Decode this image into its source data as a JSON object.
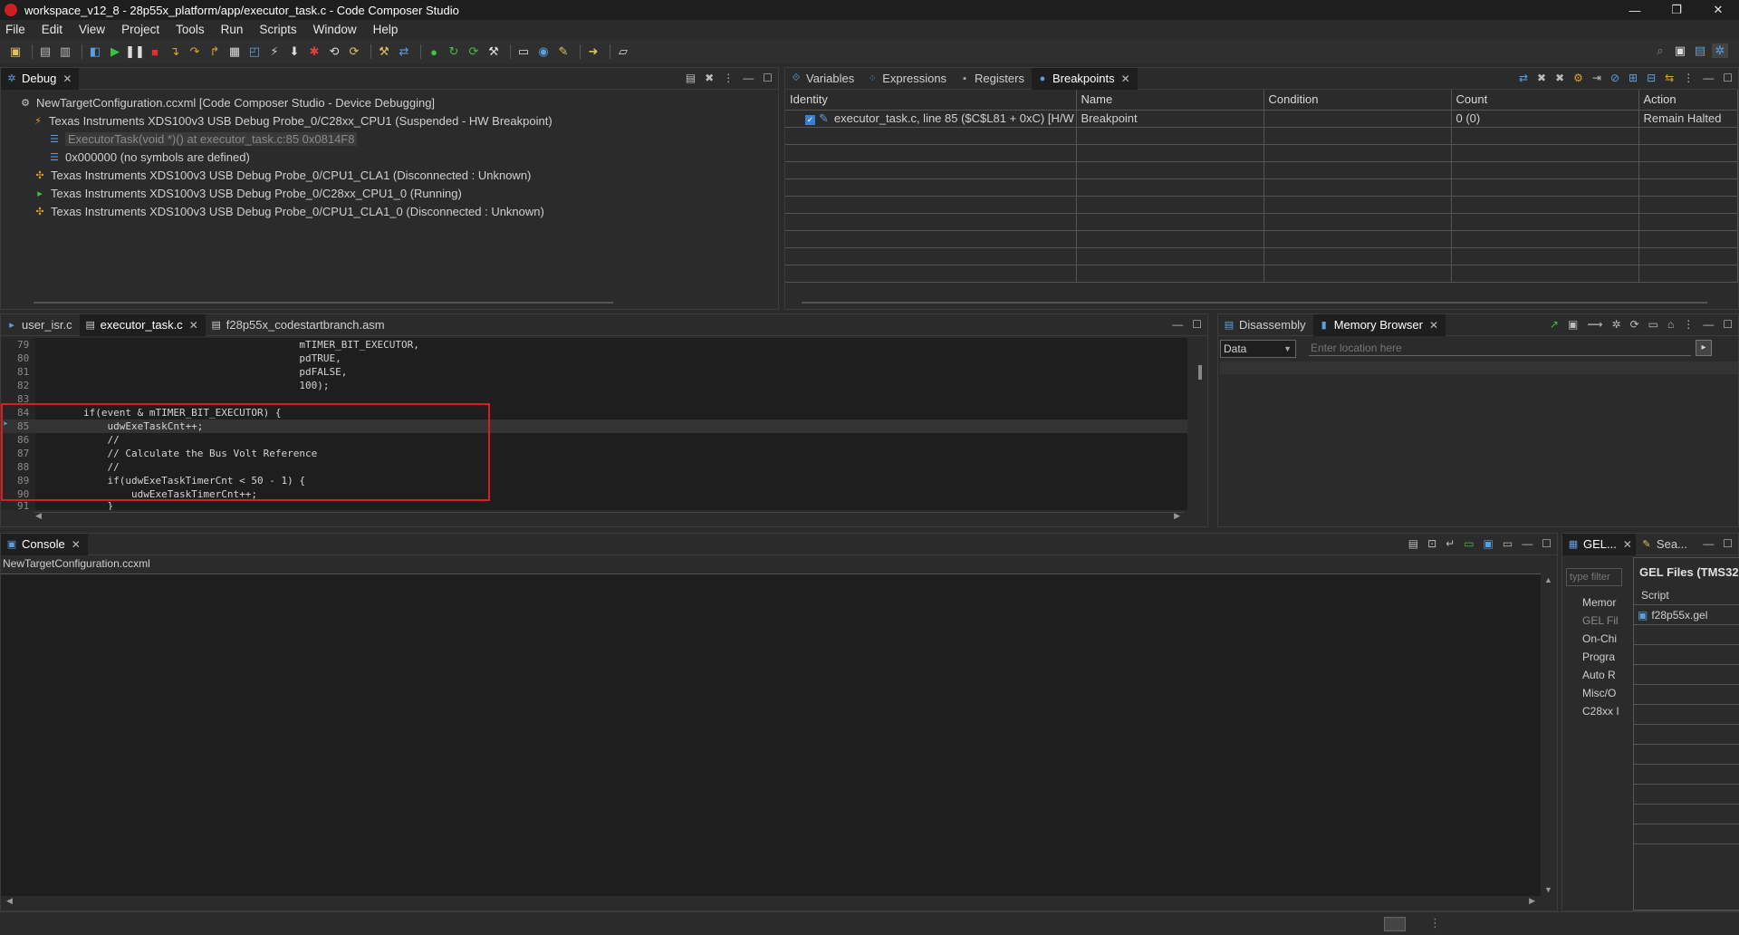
{
  "window": {
    "title": "workspace_v12_8 - 28p55x_platform/app/executor_task.c - Code Composer Studio",
    "controls": [
      "—",
      "❐",
      "✕"
    ]
  },
  "menu": [
    "File",
    "Edit",
    "View",
    "Project",
    "Tools",
    "Run",
    "Scripts",
    "Window",
    "Help"
  ],
  "debug": {
    "tab": "Debug",
    "rows": [
      {
        "text": "NewTargetConfiguration.ccxml [Code Composer Studio - Device Debugging]",
        "icon": "gear-icon"
      },
      {
        "text": "Texas Instruments XDS100v3 USB Debug Probe_0/C28xx_CPU1 (Suspended - HW Breakpoint)",
        "icon": "suspended-thread-icon"
      },
      {
        "text": "ExecutorTask(void *)() at executor_task.c:85 0x0814F8",
        "icon": "stack-frame-icon"
      },
      {
        "text": "0x000000  (no symbols are defined)",
        "icon": "stack-frame-icon"
      },
      {
        "text": "Texas Instruments XDS100v3 USB Debug Probe_0/CPU1_CLA1 (Disconnected : Unknown)",
        "icon": "disconnected-icon"
      },
      {
        "text": "Texas Instruments XDS100v3 USB Debug Probe_0/C28xx_CPU1_0 (Running)",
        "icon": "running-icon"
      },
      {
        "text": "Texas Instruments XDS100v3 USB Debug Probe_0/CPU1_CLA1_0 (Disconnected : Unknown)",
        "icon": "disconnected-icon"
      }
    ]
  },
  "breakpoints_panel": {
    "tabs": [
      "Variables",
      "Expressions",
      "Registers",
      "Breakpoints"
    ],
    "columns": [
      "Identity",
      "Name",
      "Condition",
      "Count",
      "Action"
    ],
    "rows": [
      {
        "identity": "executor_task.c, line 85 ($C$L81 + 0xC)  [H/W",
        "name": "Breakpoint",
        "condition": "",
        "count": "0 (0)",
        "action": "Remain Halted"
      }
    ]
  },
  "editor": {
    "tabs": [
      "user_isr.c",
      "executor_task.c",
      "f28p55x_codestartbranch.asm"
    ],
    "lines": [
      {
        "n": "79",
        "code": "                                            mTIMER_BIT_EXECUTOR,"
      },
      {
        "n": "80",
        "code": "                                            pdTRUE,"
      },
      {
        "n": "81",
        "code": "                                            pdFALSE,"
      },
      {
        "n": "82",
        "code": "                                            100);"
      },
      {
        "n": "83",
        "code": ""
      },
      {
        "n": "84",
        "code": "        if(event & mTIMER_BIT_EXECUTOR) {"
      },
      {
        "n": "85",
        "code": "            udwExeTaskCnt++;"
      },
      {
        "n": "86",
        "code": "            //"
      },
      {
        "n": "87",
        "code": "            // Calculate the Bus Volt Reference"
      },
      {
        "n": "88",
        "code": "            //"
      },
      {
        "n": "89",
        "code": "            if(udwExeTaskTimerCnt < 50 - 1) {"
      },
      {
        "n": "90",
        "code": "                udwExeTaskTimerCnt++;"
      },
      {
        "n": "91",
        "code": "            }"
      }
    ]
  },
  "memory": {
    "tabs": [
      "Disassembly",
      "Memory Browser"
    ],
    "select_value": "Data",
    "location_placeholder": "Enter location here"
  },
  "console": {
    "tab": "Console",
    "subtitle": "NewTargetConfiguration.ccxml"
  },
  "gel": {
    "tabs": [
      "GEL...",
      "Sea..."
    ],
    "filter_placeholder": "type filter",
    "items": [
      "Memor",
      "GEL Fil",
      "On-Chi",
      "Progra",
      "Auto R",
      "Misc/O",
      "C28xx I"
    ],
    "header": "GEL Files (TMS32",
    "script_col": "Script",
    "file": "f28p55x.gel"
  }
}
